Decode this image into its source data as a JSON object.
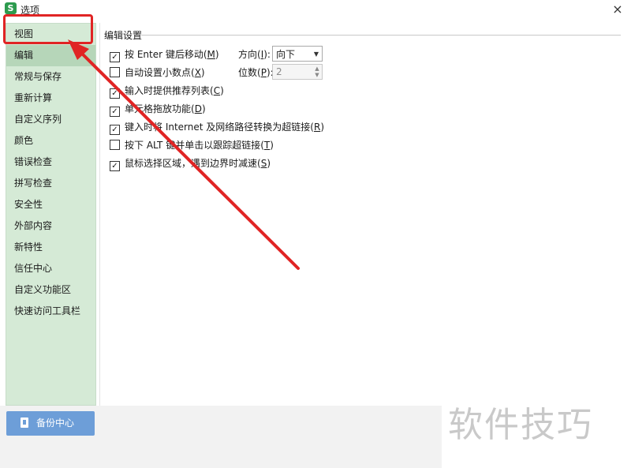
{
  "window": {
    "title": "选项",
    "app_icon_glyph": "S",
    "close_glyph": "×"
  },
  "sidebar": {
    "items": [
      {
        "label": "视图"
      },
      {
        "label": "编辑"
      },
      {
        "label": "常规与保存"
      },
      {
        "label": "重新计算"
      },
      {
        "label": "自定义序列"
      },
      {
        "label": "颜色"
      },
      {
        "label": "错误检查"
      },
      {
        "label": "拼写检查"
      },
      {
        "label": "安全性"
      },
      {
        "label": "外部内容"
      },
      {
        "label": "新特性"
      },
      {
        "label": "信任中心"
      },
      {
        "label": "自定义功能区"
      },
      {
        "label": "快速访问工具栏"
      }
    ],
    "active_index": 1,
    "backup_button": "备份中心"
  },
  "edit_settings": {
    "section_title": "编辑设置",
    "options": [
      {
        "checked": true,
        "pre": "按 Enter 键后移动(",
        "key": "M",
        "post": ")"
      },
      {
        "checked": false,
        "pre": "自动设置小数点(",
        "key": "X",
        "post": ")"
      },
      {
        "checked": true,
        "pre": "输入时提供推荐列表(",
        "key": "C",
        "post": ")"
      },
      {
        "checked": true,
        "pre": "单元格拖放功能(",
        "key": "D",
        "post": ")"
      },
      {
        "checked": true,
        "pre": "键入时将 Internet 及网络路径转换为超链接(",
        "key": "R",
        "post": ")"
      },
      {
        "checked": false,
        "pre": "按下 ALT 键并单击以跟踪超链接(",
        "key": "T",
        "post": ")"
      },
      {
        "checked": true,
        "pre": "鼠标选择区域，遇到边界时减速(",
        "key": "S",
        "post": ")"
      }
    ],
    "direction": {
      "pre": "方向(",
      "key": "I",
      "post": "):",
      "value": "向下"
    },
    "decimal_places": {
      "pre": "位数(",
      "key": "P",
      "post": "):",
      "value": "2"
    }
  },
  "watermark": "软件技巧",
  "annotation_color": "#e02424"
}
